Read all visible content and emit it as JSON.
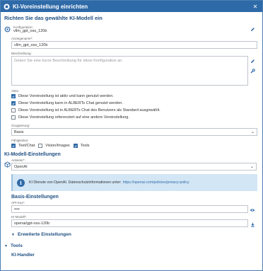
{
  "window": {
    "title": "KI-Voreinstellung einrichten"
  },
  "page": {
    "heading": "Richten Sie das gewählte KI-Modell ein"
  },
  "configuration": {
    "label": "Konfiguration:",
    "value": "vllm_gpt_oss_120b"
  },
  "display_name": {
    "label": "Anzeigename*:",
    "value": "vllm_gpt_oss_120b"
  },
  "description": {
    "label": "Beschreibung:",
    "placeholder": "Geben Sie eine kurze Beschreibung für diese Konfiguration an."
  },
  "active": {
    "label": "Aktiv:",
    "options": [
      {
        "label": "Diese Voreinstellung ist aktiv und kann genutzt werden.",
        "checked": true
      },
      {
        "label": "Diese Voreinstellung kann in ALBERTs Chat genutzt werden.",
        "checked": true
      },
      {
        "label": "Diese Voreinstellung ist in ALBERTs Chat des Benutzers als Standard ausgewählt.",
        "checked": false
      },
      {
        "label": "Diese Voreinstellung referenziert auf eine andere Voreinstellung.",
        "checked": false
      }
    ]
  },
  "grouping": {
    "label": "Gruppierung:",
    "value": "Basis"
  },
  "capabilities": {
    "label": "Fähigkeiten:",
    "options": [
      {
        "label": "Text/Chat",
        "checked": true
      },
      {
        "label": "Vision/Images",
        "checked": false
      },
      {
        "label": "Tools",
        "checked": true
      }
    ]
  },
  "ki_model": {
    "heading": "KI-Modell-Einstellungen",
    "provider_label": "Anbieter*:",
    "provider_value": "OpenAI",
    "info_text": "KI Dienste von OpenAI. Datenschutzinformationen unter:",
    "info_link": "https://openai.com/policies/privacy-policy"
  },
  "basis": {
    "heading": "Basis-Einstellungen",
    "api_key_label": "API-Key*:",
    "api_key_value": "••••",
    "model_label": "KI-Modell*:",
    "model_value": "openai/gpt-oss-120b"
  },
  "expanders": {
    "advanced": "Erweiterte Einstellungen",
    "tools": "Tools",
    "handler": "KI-Handler"
  },
  "colors": {
    "accent": "#2f6aa8",
    "heading": "#1f4f82",
    "info_bg": "#d3e6f5"
  }
}
